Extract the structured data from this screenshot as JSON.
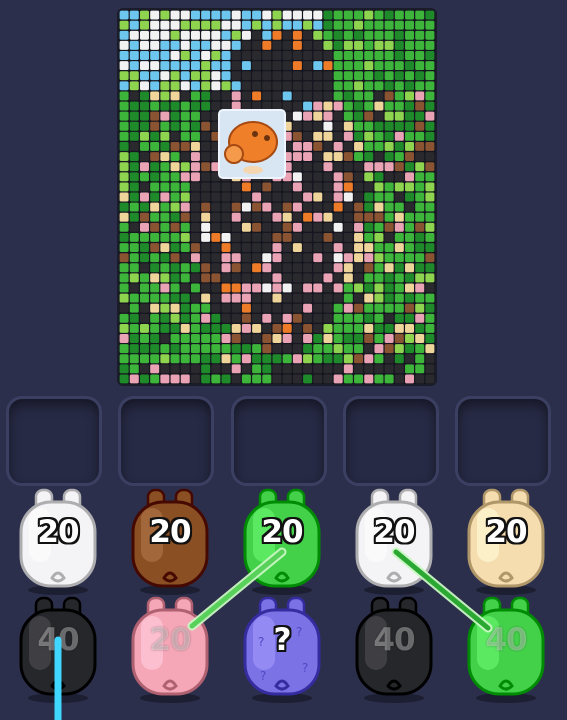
{
  "board": {
    "columns": 31,
    "rows": 37,
    "palette": {
      "sky": "#6cc6ee",
      "white": "#f2f2f2",
      "green_dark": "#1e8a2a",
      "green": "#3cb53a",
      "green_light": "#8fd44f",
      "black": "#2a2a2e",
      "pink": "#e9a3b4",
      "brown": "#8a5331",
      "cream": "#f0d59a",
      "orange": "#ee7b28"
    },
    "center_piece_icon": "orange-pig-icon"
  },
  "slots": [
    {
      "state": "empty"
    },
    {
      "state": "empty"
    },
    {
      "state": "empty"
    },
    {
      "state": "empty"
    },
    {
      "state": "empty"
    }
  ],
  "front_row": [
    {
      "color": "white",
      "count": "20"
    },
    {
      "color": "brown",
      "count": "20"
    },
    {
      "color": "green",
      "count": "20"
    },
    {
      "color": "white",
      "count": "20"
    },
    {
      "color": "cream",
      "count": "20"
    }
  ],
  "back_row": [
    {
      "color": "black",
      "count": "40"
    },
    {
      "color": "pink",
      "count": "20"
    },
    {
      "color": "mystery",
      "count": "?"
    },
    {
      "color": "black",
      "count": "40"
    },
    {
      "color": "green",
      "count": "40"
    }
  ],
  "pig_colors": {
    "white": "#f4f4f6",
    "brown": "#8b4f24",
    "green": "#44d14a",
    "cream": "#f6ddb0",
    "black": "#26272b",
    "pink": "#f5a7b7",
    "mystery": "#7b72e6"
  },
  "links": [
    {
      "from": "front_row.2",
      "to": "back_row.1",
      "color": "#7fe07a"
    },
    {
      "from": "front_row.3",
      "to": "back_row.4",
      "color": "#7fe07a"
    },
    {
      "from": "back_row.0",
      "to": "offscreen",
      "color": "#3fd6ff"
    }
  ]
}
